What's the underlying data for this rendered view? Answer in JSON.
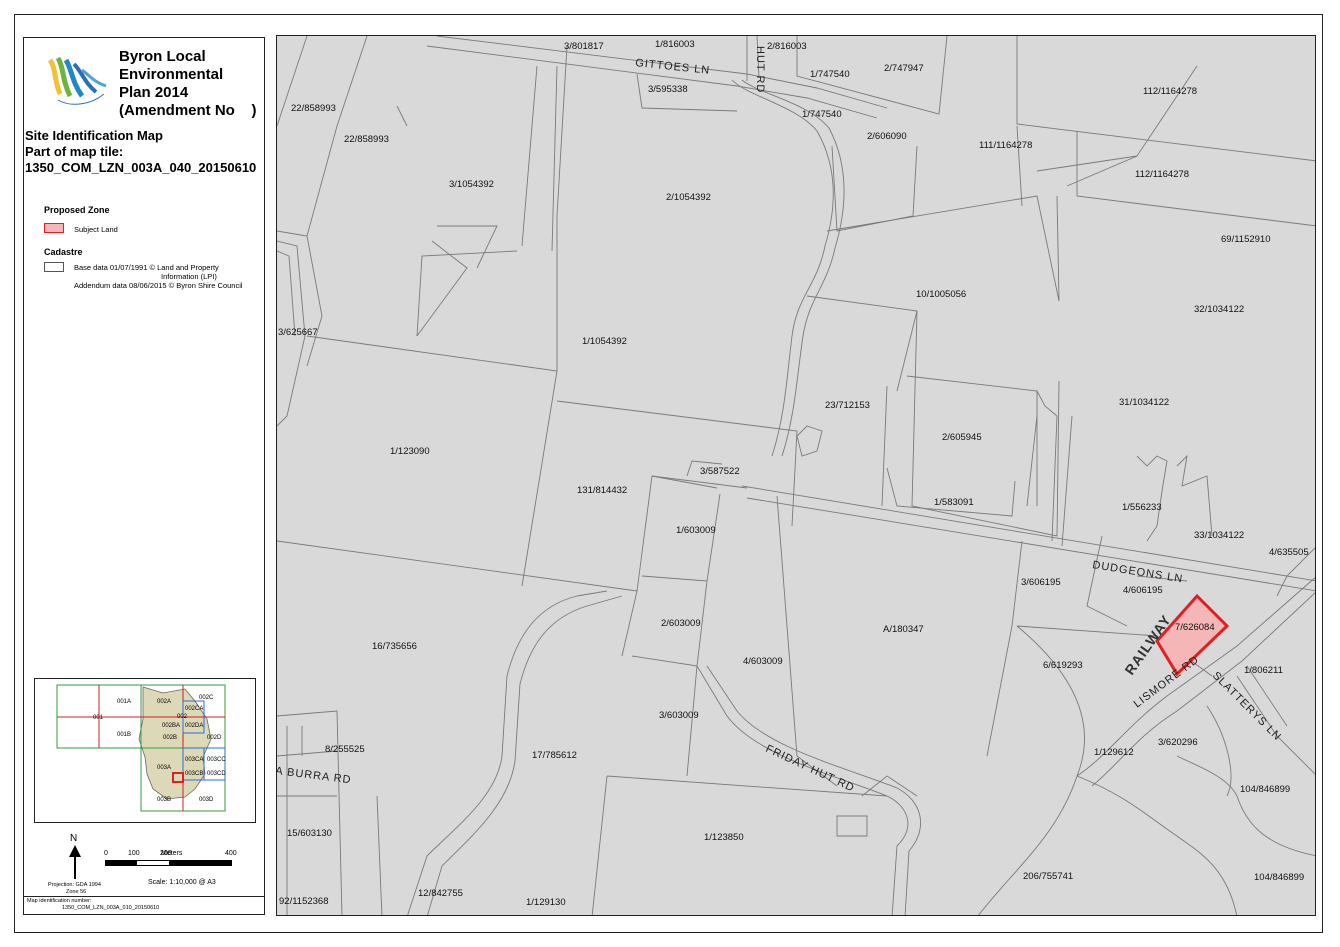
{
  "title": {
    "line1": "Byron Local",
    "line2": "Environmental",
    "line3": "Plan 2014",
    "line4": "(Amendment No    )"
  },
  "subtitle": {
    "line1": "Site Identification Map",
    "line2": "Part of map tile:",
    "line3": "1350_COM_LZN_003A_040_20150610"
  },
  "logo_text": "Byron Shire Council",
  "legend": {
    "zone_heading": "Proposed Zone",
    "subject_label": "Subject Land",
    "cadastre_heading": "Cadastre",
    "cadastre_line1": "Base data 01/07/1991 © Land and Property",
    "cadastre_line2": "Information (LPI)",
    "cadastre_line3": "Addendum data 08/06/2015 © Byron Shire Council",
    "subject_color": "#f4b6b6",
    "subject_border": "#e02020"
  },
  "inset": {
    "tiles": [
      "001",
      "001A",
      "001B",
      "002A",
      "002B",
      "002C",
      "002CA",
      "002",
      "002BA",
      "002DA",
      "002D",
      "003A",
      "003CA",
      "003CC",
      "003CB",
      "003CD",
      "003B",
      "003D"
    ]
  },
  "scale": {
    "north": "N",
    "ticks": [
      "0",
      "100",
      "200",
      "400"
    ],
    "unit": "Meters",
    "projection_line1": "Projection: GDA 1994",
    "projection_line2": "Zone 56",
    "scale_text": "Scale:  1:10,000 @ A3"
  },
  "footer": {
    "line1": "Map identification number:",
    "line2": "1350_COM_LZN_003A_010_20150610"
  },
  "map": {
    "background": "#d9d9d9",
    "roads": [
      "GITTOES LN",
      "HUT RD",
      "DUDGEONS LN",
      "RAILWAY",
      "LISMORE RD",
      "SLATTERYS LN",
      "FRIDAY HUT RD",
      "A BURRA RD"
    ],
    "lots": [
      "3/801817",
      "1/816003",
      "2/816003",
      "1/747540",
      "2/747947",
      "3/595338",
      "1/747540",
      "2/606090",
      "112/1164278",
      "111/1164278",
      "112/1164278",
      "22/858993",
      "22/858993",
      "3/1054392",
      "2/1054392",
      "69/1152910",
      "10/1005056",
      "32/1034122",
      "3/625667",
      "1/1054392",
      "23/712153",
      "31/1034122",
      "2/605945",
      "1/123090",
      "3/587522",
      "131/814432",
      "1/583091",
      "1/556233",
      "1/603009",
      "33/1034122",
      "4/635505",
      "3/606195",
      "4/606195",
      "7/626084",
      "2/603009",
      "16/735656",
      "A/180347",
      "4/603009",
      "6/619293",
      "1/806211",
      "3/603009",
      "8/255525",
      "1/129612",
      "3/620296",
      "17/785612",
      "104/846899",
      "15/603130",
      "1/123850",
      "12/842755",
      "206/755741",
      "104/846899",
      "92/1152368",
      "1/129130"
    ]
  }
}
